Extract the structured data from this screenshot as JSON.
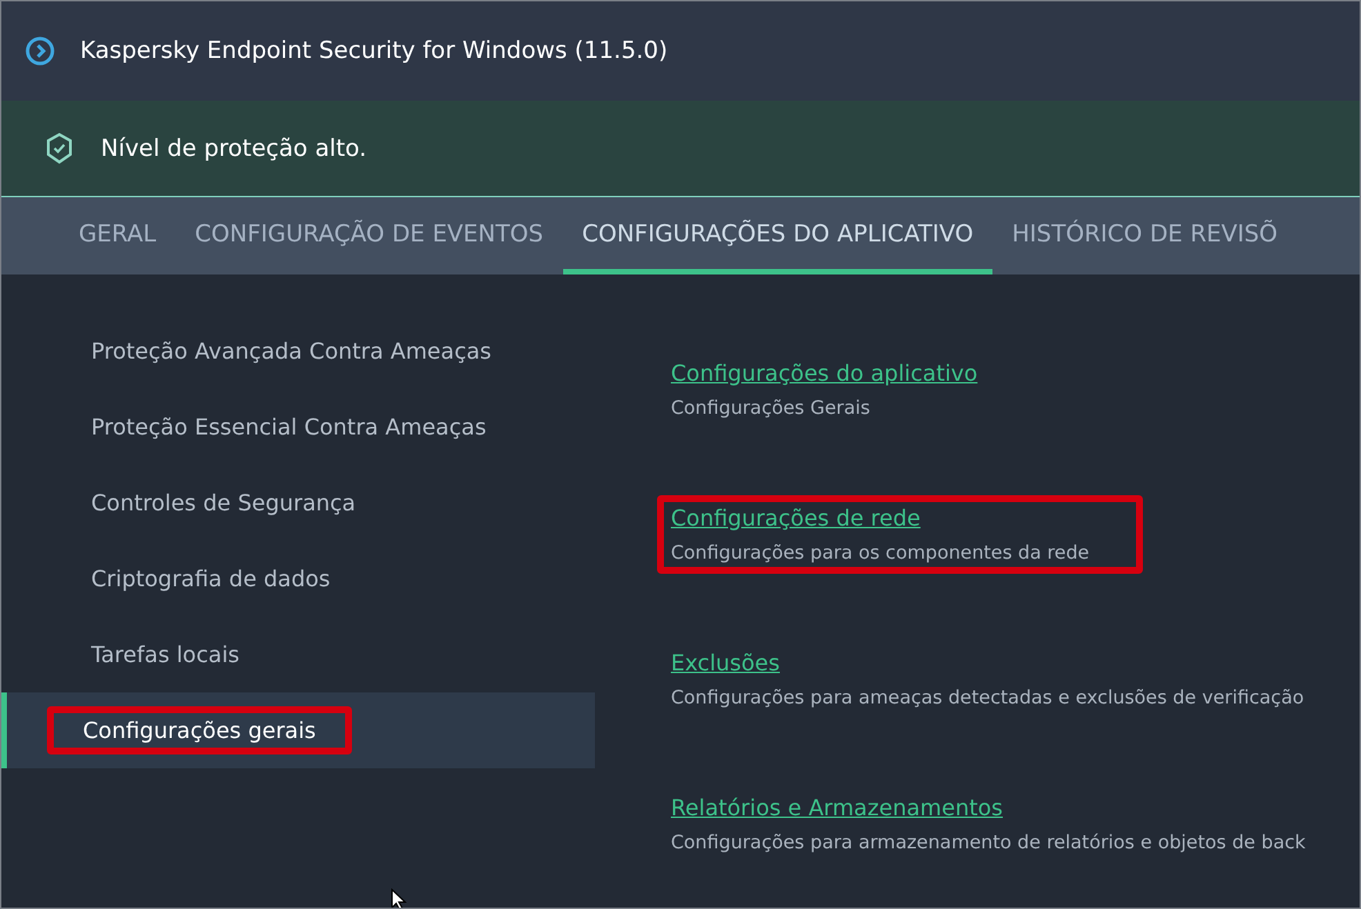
{
  "window": {
    "title": "Kaspersky Endpoint Security for Windows (11.5.0)"
  },
  "status": {
    "text": "Nível de proteção alto."
  },
  "tabs": [
    {
      "label": "GERAL",
      "selected": false
    },
    {
      "label": "CONFIGURAÇÃO DE EVENTOS",
      "selected": false
    },
    {
      "label": "CONFIGURAÇÕES DO APLICATIVO",
      "selected": true
    },
    {
      "label": "HISTÓRICO DE REVISÕ",
      "selected": false
    }
  ],
  "sidebar": {
    "items": [
      {
        "label": "Proteção Avançada Contra Ameaças",
        "selected": false,
        "highlighted": false
      },
      {
        "label": "Proteção Essencial Contra Ameaças",
        "selected": false,
        "highlighted": false
      },
      {
        "label": "Controles de Segurança",
        "selected": false,
        "highlighted": false
      },
      {
        "label": "Criptografia de dados",
        "selected": false,
        "highlighted": false
      },
      {
        "label": "Tarefas locais",
        "selected": false,
        "highlighted": false
      },
      {
        "label": "Configurações gerais",
        "selected": true,
        "highlighted": true
      }
    ]
  },
  "sections": [
    {
      "link": "Configurações do aplicativo",
      "description": "Configurações Gerais",
      "highlighted": false
    },
    {
      "link": "Configurações de rede",
      "description": "Configurações para os componentes da rede",
      "highlighted": true
    },
    {
      "link": "Exclusões",
      "description": "Configurações para ameaças detectadas e exclusões de verificação",
      "highlighted": false
    },
    {
      "link": "Relatórios e Armazenamentos",
      "description": "Configurações para armazenamento de relatórios e objetos de back",
      "highlighted": false
    }
  ]
}
